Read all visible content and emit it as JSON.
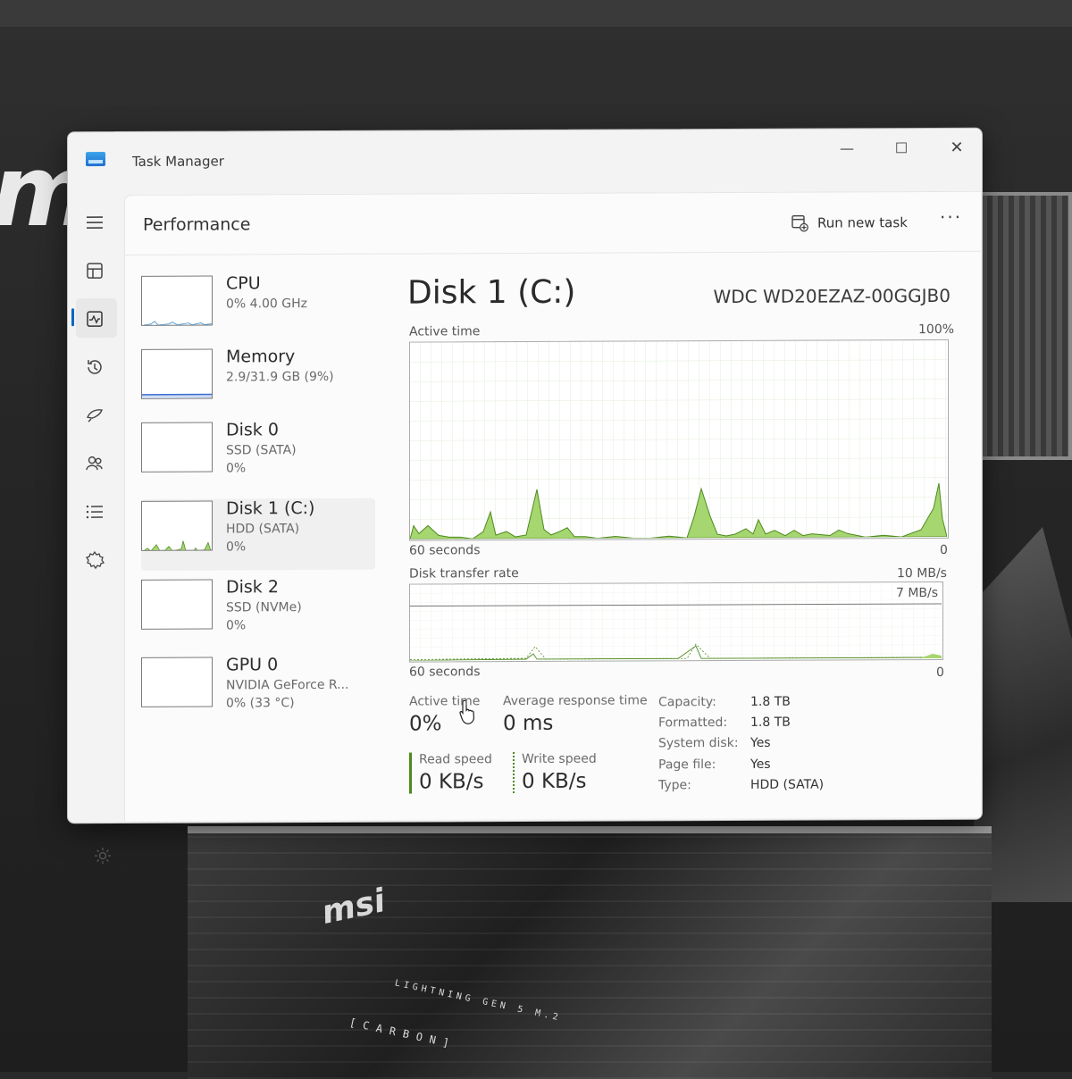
{
  "window": {
    "title": "Task Manager",
    "controls": {
      "minimize": "—",
      "maximize": "☐",
      "close": "✕"
    }
  },
  "nav": {
    "icons": [
      "menu-icon",
      "processes-icon",
      "performance-icon",
      "app-history-icon",
      "startup-apps-icon",
      "users-icon",
      "details-icon",
      "services-icon",
      "settings-icon"
    ],
    "active": "performance-icon"
  },
  "header": {
    "title": "Performance",
    "run_new_task": "Run new task",
    "more": "···"
  },
  "devices": [
    {
      "name": "CPU",
      "sub1": "0% 4.00 GHz",
      "sub2": ""
    },
    {
      "name": "Memory",
      "sub1": "2.9/31.9 GB (9%)",
      "sub2": ""
    },
    {
      "name": "Disk 0",
      "sub1": "SSD (SATA)",
      "sub2": "0%"
    },
    {
      "name": "Disk 1 (C:)",
      "sub1": "HDD (SATA)",
      "sub2": "0%",
      "selected": true
    },
    {
      "name": "Disk 2",
      "sub1": "SSD (NVMe)",
      "sub2": "0%"
    },
    {
      "name": "GPU 0",
      "sub1": "NVIDIA GeForce R...",
      "sub2": "0% (33 °C)"
    }
  ],
  "detail": {
    "title": "Disk 1 (C:)",
    "model": "WDC WD20EZAZ-00GGJB0",
    "graph1": {
      "label": "Active time",
      "max_label": "100%",
      "x_label_left": "60 seconds",
      "x_label_right": "0"
    },
    "graph2": {
      "label": "Disk transfer rate",
      "max_label": "10 MB/s",
      "line_label": "7 MB/s",
      "x_label_left": "60 seconds",
      "x_label_right": "0"
    },
    "stats": {
      "active_time_label": "Active time",
      "active_time_value": "0%",
      "avg_response_label": "Average response time",
      "avg_response_value": "0 ms",
      "read_speed_label": "Read speed",
      "read_speed_value": "0 KB/s",
      "write_speed_label": "Write speed",
      "write_speed_value": "0 KB/s"
    },
    "properties": [
      {
        "label": "Capacity:",
        "value": "1.8 TB"
      },
      {
        "label": "Formatted:",
        "value": "1.8 TB"
      },
      {
        "label": "System disk:",
        "value": "Yes"
      },
      {
        "label": "Page file:",
        "value": "Yes"
      },
      {
        "label": "Type:",
        "value": "HDD (SATA)"
      }
    ]
  },
  "wallpaper": {
    "logo_text": "m",
    "board_brand": "msi",
    "board_text_1": "LIGHTNING GEN 5 M.2",
    "board_text_2": "[CARBON]"
  },
  "colors": {
    "accent": "#0067c0",
    "disk_graph_line": "#4e8a1f",
    "disk_graph_fill": "#a6d66f",
    "memory_graph": "#3b6fd0"
  }
}
